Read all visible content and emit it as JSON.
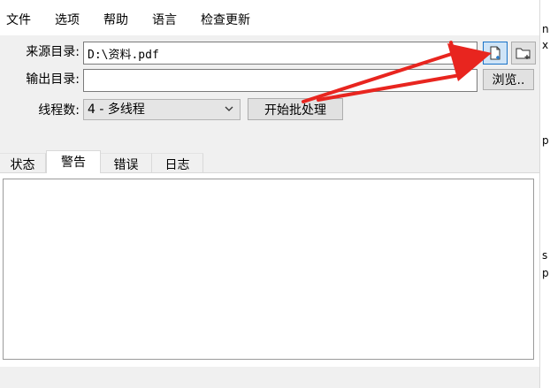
{
  "menu": [
    "文件",
    "选项",
    "帮助",
    "语言",
    "检查更新"
  ],
  "source": {
    "label": "来源目录:",
    "value": "D:\\资料.pdf"
  },
  "output": {
    "label": "输出目录:",
    "value": "",
    "browse_label": "浏览.."
  },
  "threads": {
    "label": "线程数:",
    "selected": "4 - 多线程"
  },
  "start_button": "开始批处理",
  "tabs": [
    "状态",
    "警告",
    "错误",
    "日志"
  ],
  "active_tab": "警告",
  "edge_glyphs": [
    "n",
    "x",
    "p",
    "s",
    "p"
  ],
  "colors": {
    "annotation_arrow": "#e8251f",
    "icon_highlight": "#1a73c8"
  }
}
